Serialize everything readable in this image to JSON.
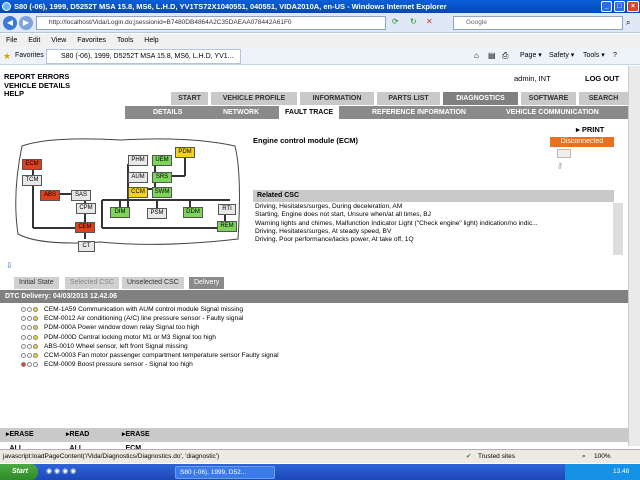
{
  "window": {
    "title": "S80 (-06), 1999, D5252T MSA 15.8, MS6, L.H.D, YV1TS72X1040551, 040551, VIDA2010A, en-US - Windows Internet Explorer",
    "minimize": "_",
    "maximize": "□",
    "close": "×"
  },
  "browser": {
    "url": "http://localhost/Vida/Login.do;jsessionid=B7480DB4864A2C35DAEAA078442A61F0",
    "search_placeholder": "Google",
    "menu": [
      "File",
      "Edit",
      "View",
      "Favorites",
      "Tools",
      "Help"
    ],
    "favorites_label": "Favorites",
    "tab_title": "S80 (-06), 1999, D5252T MSA 15.8, MS6, L.H.D, YV1...",
    "toolbar_right": [
      "Page ▾",
      "Safety ▾",
      "Tools ▾"
    ]
  },
  "app": {
    "top_links": [
      "REPORT ERRORS",
      "VEHICLE DETAILS",
      "HELP"
    ],
    "user": "admin, INT",
    "logout": "LOG OUT",
    "main_tabs": [
      {
        "label": "START"
      },
      {
        "label": "VEHICLE PROFILE"
      },
      {
        "label": "INFORMATION"
      },
      {
        "label": "PARTS LIST"
      },
      {
        "label": "DIAGNOSTICS"
      },
      {
        "label": "SOFTWARE"
      },
      {
        "label": "SEARCH"
      }
    ],
    "sub_tabs": [
      {
        "label": "DETAILS"
      },
      {
        "label": "NETWORK"
      },
      {
        "label": "FAULT TRACE"
      },
      {
        "label": "REFERENCE INFORMATION"
      },
      {
        "label": "VEHICLE COMMUNICATION"
      }
    ],
    "print": "PRINT",
    "module_title": "Engine control module (ECM)",
    "status": "Disconnected",
    "network_nodes": [
      "ECM",
      "TCM",
      "ABS",
      "SAS",
      "CPM",
      "CEM",
      "CT",
      "PHM",
      "UEM",
      "PDM",
      "AUM",
      "SRS",
      "CCM",
      "SWM",
      "DIM",
      "PSM",
      "DDM",
      "RTI",
      "REM"
    ],
    "related_csc": {
      "header": "Related CSC",
      "items": [
        "Driving, Hesitates/surges, During deceleration, AM",
        "Starting, Engine does not start, Unsure when/at all times, BJ",
        "Warning lights and chimes, Malfunction Indicator Light (\"Check engine\" light) indication/no indic...",
        "Driving, Hesitates/surges, At steady speed, BV",
        "Driving, Poor performance/lacks power, At take off, 1Q"
      ]
    },
    "bottom_tabs": [
      {
        "label": "Initial State"
      },
      {
        "label": "Selected CSC"
      },
      {
        "label": "Unselected CSC"
      },
      {
        "label": "Delivery"
      }
    ],
    "dtc_header": "DTC Delivery: 04/03/2013 12.42.06",
    "dtc_list": [
      "CEM-1A59 Communication with AUM control module Signal missing",
      "ECM-0012 Air conditioning (A/C) line pressure sensor - Faulty signal",
      "PDM-000A Power window down relay Signal too high",
      "PDM-000D Central locking motor M1 or M3 Signal too high",
      "ABS-0010 Wheel sensor, left front Signal missing",
      "CCM-0003 Fan motor passenger compartment temperature sensor Faulty signal",
      "ECM-0009 Boost pressure sensor - Signal too high"
    ],
    "actions": [
      "ERASE ALL",
      "READ ALL",
      "ERASE ECM"
    ]
  },
  "statusbar": {
    "left": "javascript:loadPageContent('/Vida/Diagnostics/Diagnostics.do', 'diagnostic')",
    "zone": "Trusted sites",
    "zoom": "100%"
  },
  "taskbar": {
    "start": "Start",
    "task": "S80 (-06), 1999, D52...",
    "clock": "13.48"
  }
}
